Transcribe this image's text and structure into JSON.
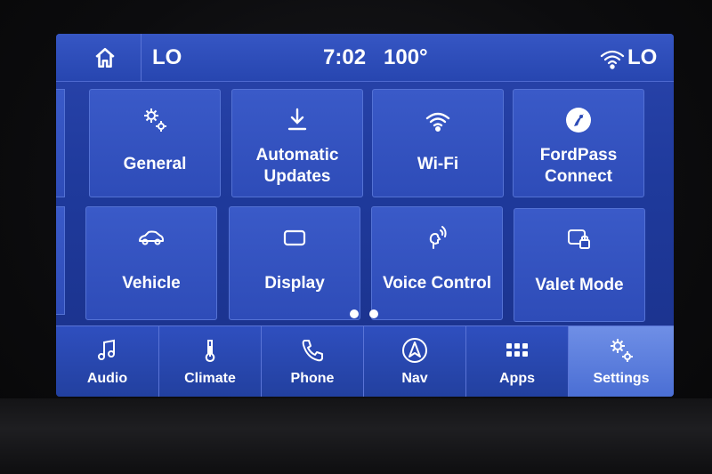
{
  "status": {
    "home_icon": "home-icon",
    "left_climate": "LO",
    "time": "7:02",
    "outside_temp": "100°",
    "wifi_icon": "wifi-icon",
    "right_climate": "LO"
  },
  "tiles": [
    {
      "label": "General",
      "icon": "gears-icon"
    },
    {
      "label": "Automatic Updates",
      "icon": "download-icon"
    },
    {
      "label": "Wi-Fi",
      "icon": "wifi-icon"
    },
    {
      "label": "FordPass Connect",
      "icon": "fordpass-icon"
    },
    {
      "label": "Vehicle",
      "icon": "car-icon"
    },
    {
      "label": "Display",
      "icon": "display-icon"
    },
    {
      "label": "Voice Control",
      "icon": "voice-icon"
    },
    {
      "label": "Valet Mode",
      "icon": "valet-lock-icon"
    }
  ],
  "tile_labels_split": {
    "automatic_line1": "Automatic",
    "automatic_line2": "Updates",
    "fordpass_line1": "FordPass",
    "fordpass_line2": "Connect"
  },
  "page_indicator": {
    "pages": 2
  },
  "nav": [
    {
      "label": "Audio",
      "icon": "music-note-icon"
    },
    {
      "label": "Climate",
      "icon": "thermometer-icon"
    },
    {
      "label": "Phone",
      "icon": "phone-icon"
    },
    {
      "label": "Nav",
      "icon": "navigation-arrow-icon"
    },
    {
      "label": "Apps",
      "icon": "apps-grid-icon"
    },
    {
      "label": "Settings",
      "icon": "gears-icon",
      "active": true
    }
  ],
  "colors": {
    "screen_blue": "#2a45ad",
    "active_tab": "#6f8fe6",
    "text": "#ffffff"
  }
}
